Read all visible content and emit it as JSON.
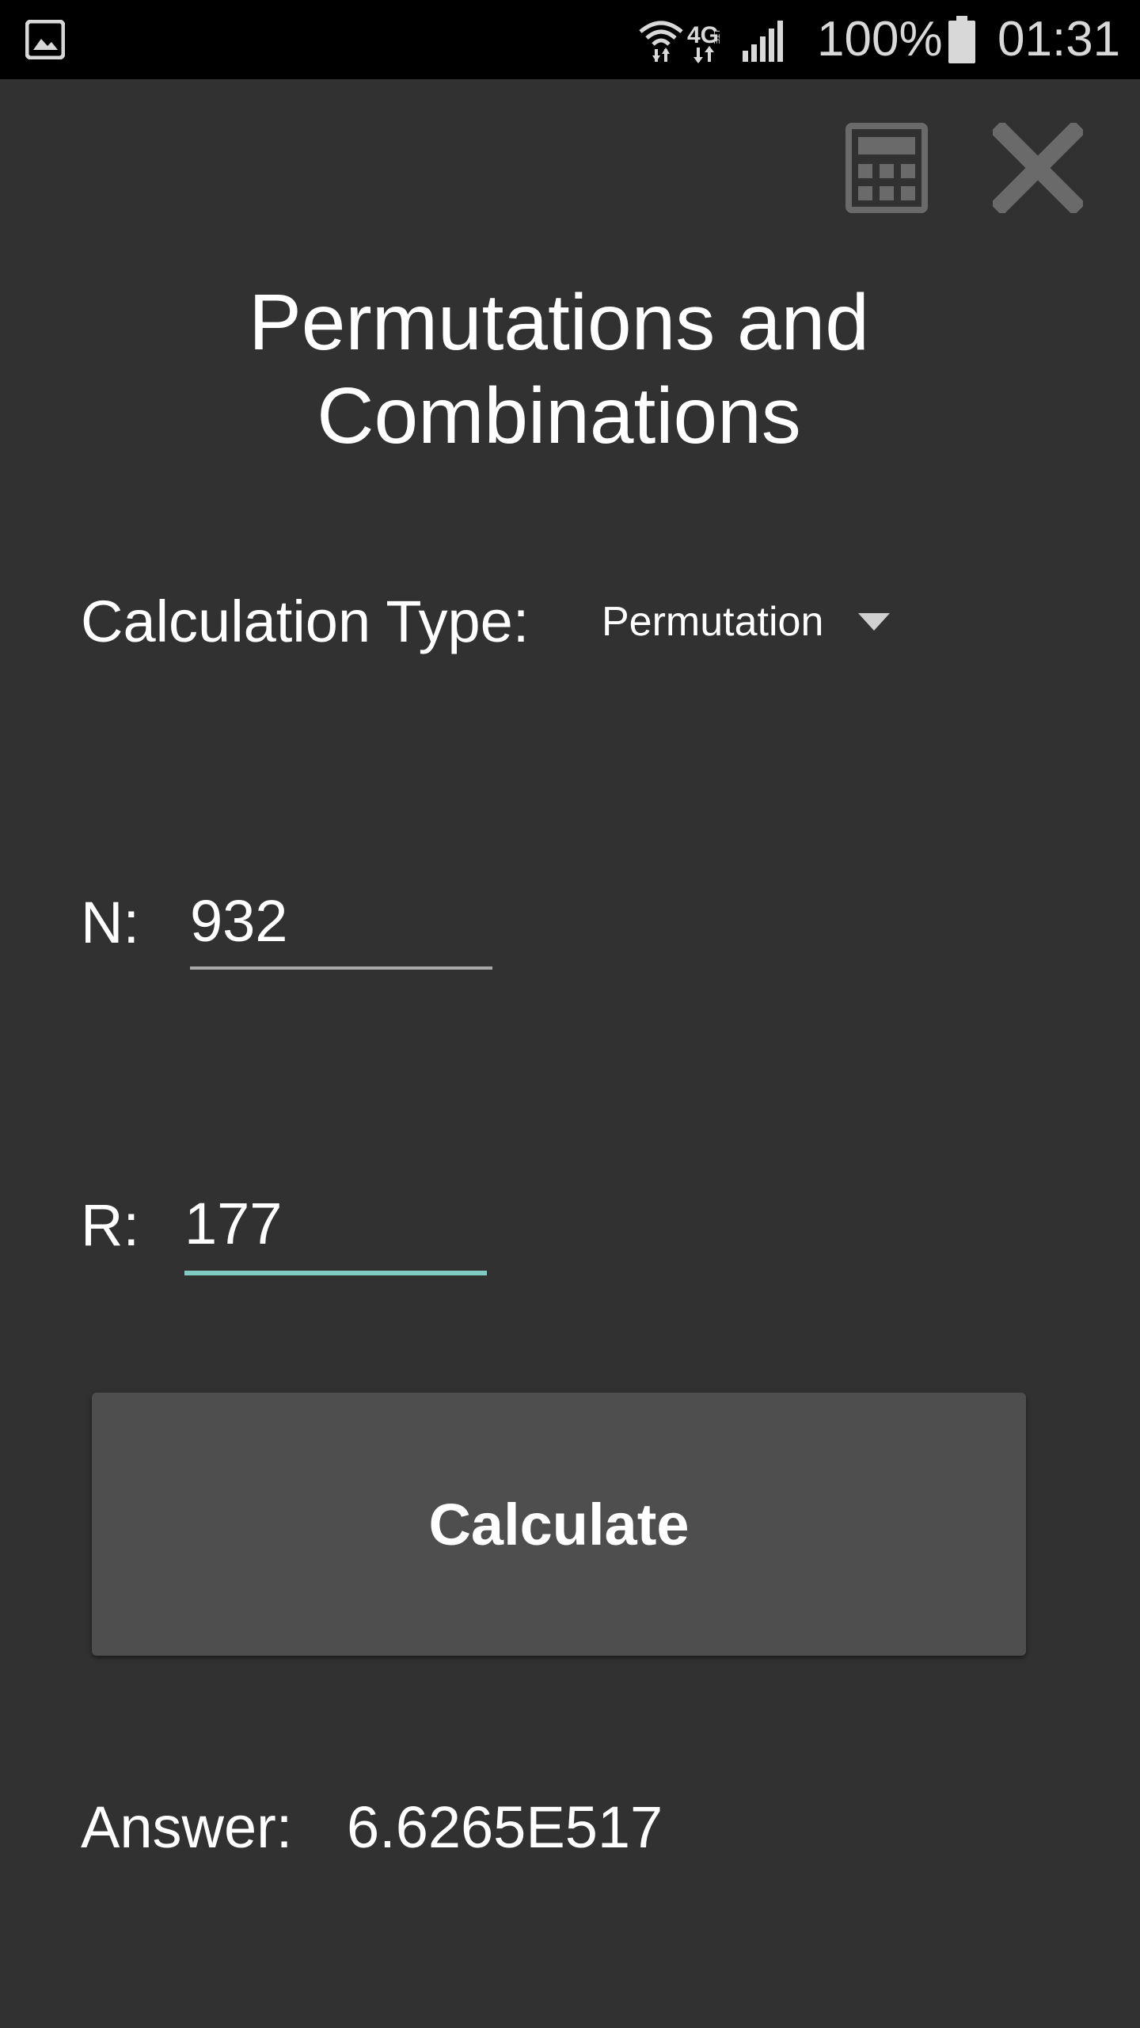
{
  "status_bar": {
    "battery_percent": "100%",
    "time": "01:31",
    "network_type": "4G",
    "network_sub": "LTE",
    "icons": [
      "gallery-icon",
      "wifi-icon",
      "lte-icon",
      "signal-icon",
      "battery-icon"
    ]
  },
  "toolbar": {
    "calculator_icon": "calculator-icon",
    "close_icon": "close-icon"
  },
  "page": {
    "title_line1": "Permutations and",
    "title_line2": "Combinations"
  },
  "form": {
    "calc_type_label": "Calculation Type:",
    "calc_type_value": "Permutation",
    "n_label": "N:",
    "n_value": "932",
    "r_label": "R:",
    "r_value": "177",
    "calculate_label": "Calculate",
    "answer_label": "Answer:",
    "answer_value": "6.6265E517"
  },
  "colors": {
    "background": "#313131",
    "status_bar": "#000000",
    "button": "#4e4e4e",
    "accent": "#80cbc4",
    "icon_gray": "#6a6a6a"
  }
}
